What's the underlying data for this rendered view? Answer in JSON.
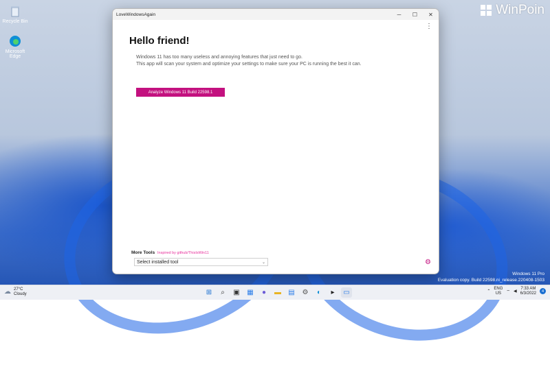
{
  "desktop": {
    "icons": [
      {
        "label": "Recycle Bin",
        "icon": "recycle-bin-icon"
      },
      {
        "label": "Microsoft Edge",
        "icon": "edge-icon"
      }
    ],
    "watermark": {
      "brand": "WinPoin",
      "edition": "Windows 11 Pro",
      "build": "Evaluation copy. Build 22598.ni_release.220408-1503"
    }
  },
  "window": {
    "title": "LoveWindowsAgain",
    "controls": {
      "minimize": "─",
      "maximize": "☐",
      "close": "✕"
    },
    "menu_glyph": "⋮",
    "heading": "Hello friend!",
    "description": [
      "Windows 11 has too many useless and annoying features that just need to go.",
      "This app will scan your system and optimize your settings to make sure your PC is running the best it can."
    ],
    "analyze_label": "Analyze Windows 11 Build 22598.1",
    "more_tools_label": "More Tools",
    "inspired_link": "Inspired by github/ThisIsWin11",
    "tool_select": {
      "selected": "Select installed tool",
      "chevron": "⌄"
    },
    "settings_glyph": "⚙",
    "accent": "#c3117f"
  },
  "taskbar": {
    "weather": {
      "temp": "27°C",
      "condition": "Cloudy",
      "glyph": "☁"
    },
    "apps": [
      {
        "name": "start-icon",
        "glyph": "⊞",
        "color": "#1a6fd1"
      },
      {
        "name": "search-icon",
        "glyph": "⌕",
        "color": "#333333"
      },
      {
        "name": "task-view-icon",
        "glyph": "▣",
        "color": "#333333"
      },
      {
        "name": "widgets-icon",
        "glyph": "▦",
        "color": "#2b7de9"
      },
      {
        "name": "chat-icon",
        "glyph": "●",
        "color": "#6b5bd6"
      },
      {
        "name": "file-explorer-icon",
        "glyph": "▬",
        "color": "#e8b424"
      },
      {
        "name": "store-icon",
        "glyph": "▤",
        "color": "#2b7de9"
      },
      {
        "name": "settings-app-icon",
        "glyph": "⚙",
        "color": "#555555"
      },
      {
        "name": "edge-taskbar-icon",
        "glyph": "◐",
        "color": "#0f8fd6"
      },
      {
        "name": "terminal-icon",
        "glyph": "▸",
        "color": "#222222"
      },
      {
        "name": "app-icon",
        "glyph": "▭",
        "color": "#2b7de9"
      }
    ],
    "tray": {
      "chevron": "⌃",
      "lang": "ENG",
      "region": "US",
      "net": "⌔",
      "volume": "◀",
      "time": "7:33 AM",
      "date": "6/3/2022",
      "notifications": "4"
    }
  }
}
